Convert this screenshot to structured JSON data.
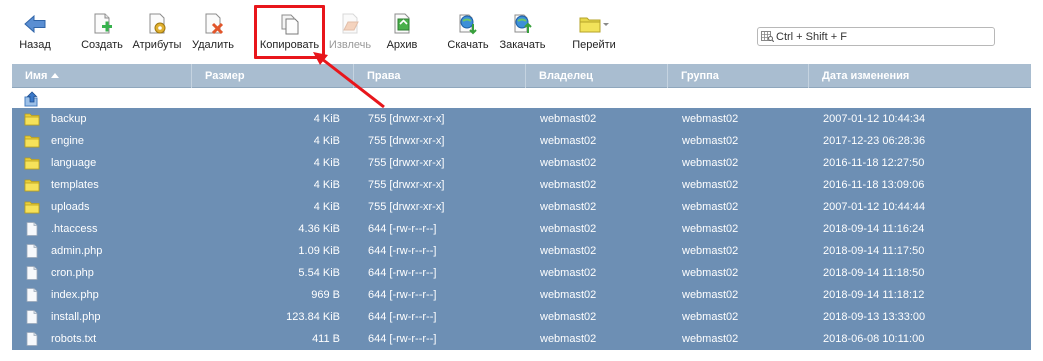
{
  "toolbar": {
    "back": "Назад",
    "create": "Создать",
    "attributes": "Атрибуты",
    "delete": "Удалить",
    "copy": "Копировать",
    "extract": "Извлечь",
    "archive": "Архив",
    "download": "Скачать",
    "upload": "Закачать",
    "goto": "Перейти"
  },
  "search": {
    "placeholder": "Ctrl + Shift + F"
  },
  "columns": {
    "name": "Имя",
    "size": "Размер",
    "perms": "Права",
    "owner": "Владелец",
    "group": "Группа",
    "modified": "Дата изменения"
  },
  "files": [
    {
      "type": "folder",
      "name": "backup",
      "size": "4 KiB",
      "perms": "755 [drwxr-xr-x]",
      "owner": "webmast02",
      "group": "webmast02",
      "modified": "2007-01-12 10:44:34"
    },
    {
      "type": "folder",
      "name": "engine",
      "size": "4 KiB",
      "perms": "755 [drwxr-xr-x]",
      "owner": "webmast02",
      "group": "webmast02",
      "modified": "2017-12-23 06:28:36"
    },
    {
      "type": "folder",
      "name": "language",
      "size": "4 KiB",
      "perms": "755 [drwxr-xr-x]",
      "owner": "webmast02",
      "group": "webmast02",
      "modified": "2016-11-18 12:27:50"
    },
    {
      "type": "folder",
      "name": "templates",
      "size": "4 KiB",
      "perms": "755 [drwxr-xr-x]",
      "owner": "webmast02",
      "group": "webmast02",
      "modified": "2016-11-18 13:09:06"
    },
    {
      "type": "folder",
      "name": "uploads",
      "size": "4 KiB",
      "perms": "755 [drwxr-xr-x]",
      "owner": "webmast02",
      "group": "webmast02",
      "modified": "2007-01-12 10:44:44"
    },
    {
      "type": "file",
      "name": ".htaccess",
      "size": "4.36 KiB",
      "perms": "644 [-rw-r--r--]",
      "owner": "webmast02",
      "group": "webmast02",
      "modified": "2018-09-14 11:16:24"
    },
    {
      "type": "file",
      "name": "admin.php",
      "size": "1.09 KiB",
      "perms": "644 [-rw-r--r--]",
      "owner": "webmast02",
      "group": "webmast02",
      "modified": "2018-09-14 11:17:50"
    },
    {
      "type": "file",
      "name": "cron.php",
      "size": "5.54 KiB",
      "perms": "644 [-rw-r--r--]",
      "owner": "webmast02",
      "group": "webmast02",
      "modified": "2018-09-14 11:18:50"
    },
    {
      "type": "file",
      "name": "index.php",
      "size": "969 B",
      "perms": "644 [-rw-r--r--]",
      "owner": "webmast02",
      "group": "webmast02",
      "modified": "2018-09-14 11:18:12"
    },
    {
      "type": "file",
      "name": "install.php",
      "size": "123.84 KiB",
      "perms": "644 [-rw-r--r--]",
      "owner": "webmast02",
      "group": "webmast02",
      "modified": "2018-09-13 13:33:00"
    },
    {
      "type": "file",
      "name": "robots.txt",
      "size": "411 B",
      "perms": "644 [-rw-r--r--]",
      "owner": "webmast02",
      "group": "webmast02",
      "modified": "2018-06-08 10:11:00"
    }
  ],
  "colors": {
    "header_bg": "#a9bdd0",
    "selected_row_bg": "#6d8fb4",
    "highlight_red": "#e8161b"
  }
}
